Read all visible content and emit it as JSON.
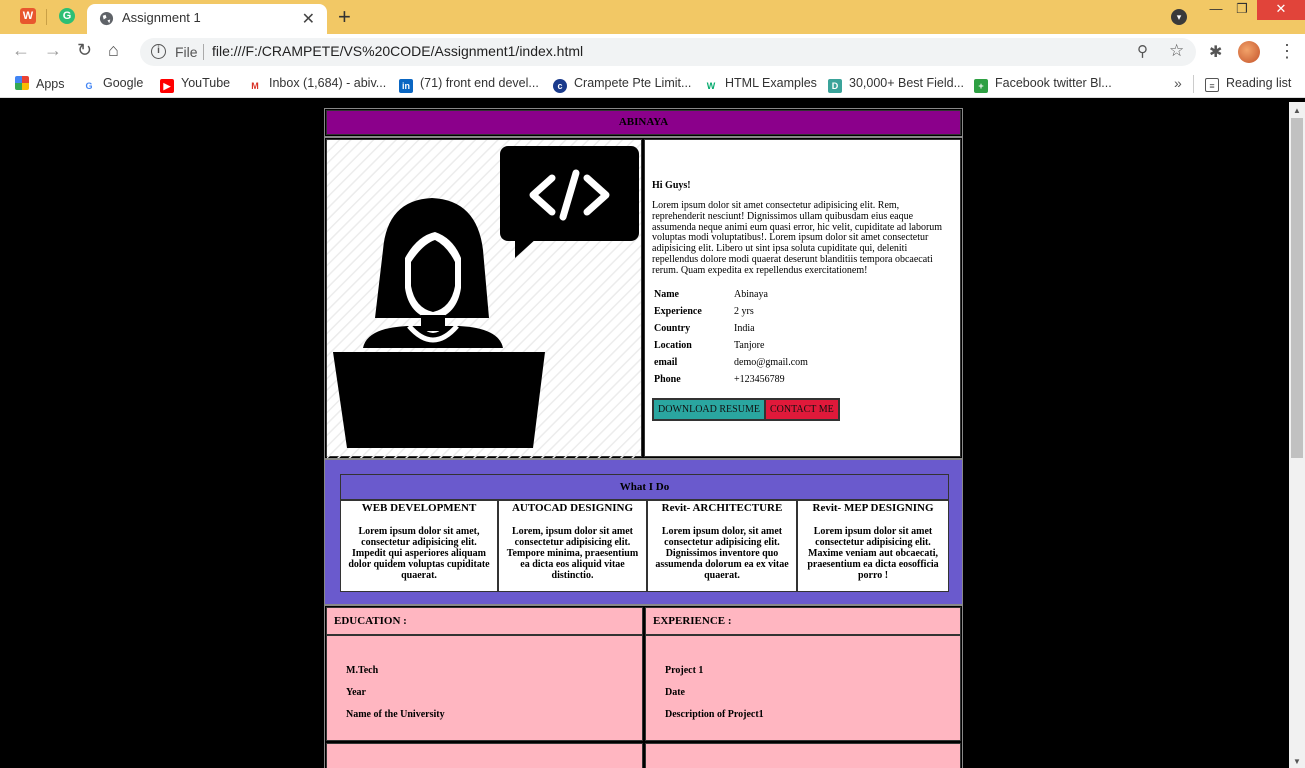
{
  "browser": {
    "pinned_tabs": [
      {
        "name": "W",
        "color": "#e8572e"
      },
      {
        "name": "G",
        "color": "#2dbf74"
      }
    ],
    "active_tab": {
      "title": "Assignment 1",
      "close": "✕"
    },
    "new_tab": "+",
    "window_controls": {
      "minimize": "—",
      "maximize": "❐",
      "close": "✕"
    },
    "address": {
      "scheme_label": "File",
      "url": "file:///F:/CRAMPETE/VS%20CODE/Assignment1/index.html"
    },
    "bookmarks": [
      {
        "label": "Apps",
        "icon": "apps-grid-icon"
      },
      {
        "label": "Google",
        "icon": "google-icon"
      },
      {
        "label": "YouTube",
        "icon": "youtube-icon"
      },
      {
        "label": "Inbox (1,684) - abiv...",
        "icon": "gmail-icon"
      },
      {
        "label": "(71) front end devel...",
        "icon": "linkedin-icon"
      },
      {
        "label": "Crampete Pte Limit...",
        "icon": "crampete-icon"
      },
      {
        "label": "HTML Examples",
        "icon": "w3schools-icon"
      },
      {
        "label": "30,000+ Best Field...",
        "icon": "field-icon"
      },
      {
        "label": "Facebook twitter Bl...",
        "icon": "facebook-ext-icon"
      }
    ],
    "more_bookmarks": "»",
    "reading_list": "Reading list"
  },
  "page": {
    "header": "ABINAYA",
    "greeting": "Hi Guys!",
    "intro": "Lorem ipsum dolor sit amet consectetur adipisicing elit. Rem, reprehenderit nesciunt! Dignissimos ullam quibusdam eius eaque assumenda neque animi eum quasi error, hic velit, cupiditate ad laborum voluptas modi voluptatibus!. Lorem ipsum dolor sit amet consectetur adipisicing elit. Libero ut sint ipsa soluta cupiditate qui, deleniti repellendus dolore modi quaerat deserunt blanditiis tempora obcaecati rerum. Quam expedita ex repellendus exercitationem!",
    "details": [
      {
        "key": "Name",
        "value": "Abinaya"
      },
      {
        "key": "Experience",
        "value": "2 yrs"
      },
      {
        "key": "Country",
        "value": "India"
      },
      {
        "key": "Location",
        "value": "Tanjore"
      },
      {
        "key": "email",
        "value": "demo@gmail.com"
      },
      {
        "key": "Phone",
        "value": "+123456789"
      }
    ],
    "buttons": {
      "download": "DOWNLOAD RESUME",
      "contact": "CONTACT ME"
    },
    "what_i_do": {
      "title": "What I Do",
      "items": [
        {
          "title": "WEB DEVELOPMENT",
          "text": "Lorem ipsum dolor sit amet, consectetur adipisicing elit. Impedit qui asperiores aliquam dolor quidem voluptas cupiditate quaerat."
        },
        {
          "title": "AUTOCAD DESIGNING",
          "text": "Lorem, ipsum dolor sit amet consectetur adipisicing elit. Tempore minima, praesentium ea dicta eos aliquid vitae distinctio."
        },
        {
          "title": "Revit- ARCHITECTURE",
          "text": "Lorem ipsum dolor, sit amet consectetur adipisicing elit. Dignissimos inventore quo assumenda dolorum ea ex vitae quaerat."
        },
        {
          "title": "Revit- MEP DESIGNING",
          "text": "Lorem ipsum dolor sit amet consectetur adipisicing elit. Maxime veniam aut obcaecati, praesentium ea dicta eosofficia porro !"
        }
      ]
    },
    "education": {
      "title": "EDUCATION :",
      "lines": [
        "M.Tech",
        "Year",
        "Name of the University"
      ]
    },
    "experience": {
      "title": "EXPERIENCE :",
      "lines": [
        "Project 1",
        "Date",
        "Description of Project1"
      ]
    }
  },
  "colors": {
    "tabstrip": "#f2c865",
    "header": "#8b008b",
    "what_i_do_bg": "#6a5acd",
    "download_btn": "#2aa6a0",
    "contact_btn": "#e0193a",
    "pink_cells": "#ffb6c1"
  }
}
